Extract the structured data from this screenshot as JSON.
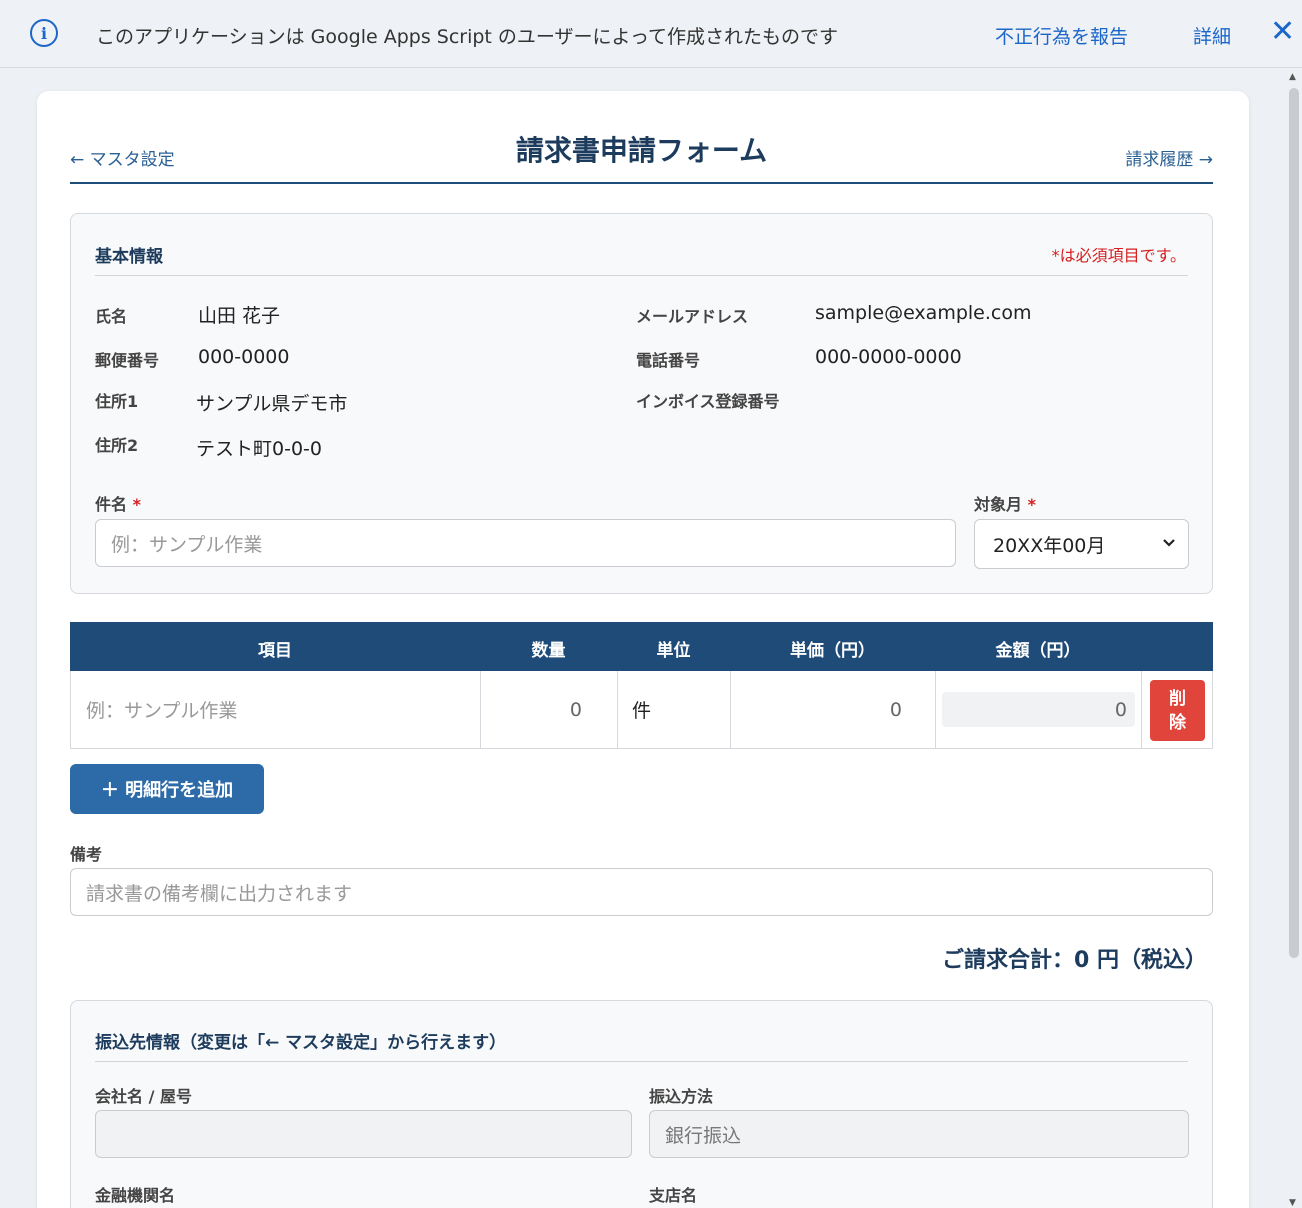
{
  "banner": {
    "message": "このアプリケーションは Google Apps Script のユーザーによって作成されたものです",
    "report": "不正行為を報告",
    "details": "詳細",
    "close": "✕"
  },
  "header": {
    "back_link": "← マスタ設定",
    "title": "請求書申請フォーム",
    "history_link": "請求履歴 →"
  },
  "basic": {
    "title": "基本情報",
    "required_note": "*は必須項目です。",
    "name_label": "氏名",
    "name_value": "山田 花子",
    "email_label": "メールアドレス",
    "email_value": "sample@example.com",
    "postal_label": "郵便番号",
    "postal_value": "000-0000",
    "phone_label": "電話番号",
    "phone_value": "000-0000-0000",
    "address1_label": "住所1",
    "address1_value": "サンプル県デモ市",
    "invoice_label": "インボイス登録番号",
    "address2_label": "住所2",
    "address2_value": "テスト町0-0-0",
    "subject_label": "件名",
    "subject_placeholder": "例：サンプル作業",
    "month_label": "対象月",
    "month_value": "20XX年00月",
    "required_mark": "*"
  },
  "items_table": {
    "headers": [
      "項目",
      "数量",
      "単位",
      "単価（円）",
      "金額（円）"
    ],
    "row": {
      "item_placeholder": "例：サンプル作業",
      "quantity": "0",
      "unit": "件",
      "unit_price": "0",
      "amount": "0",
      "delete_label": "削除"
    },
    "add_button": "＋ 明細行を追加"
  },
  "remarks": {
    "label": "備考",
    "placeholder": "請求書の備考欄に出力されます"
  },
  "total": "ご請求合計：0 円（税込）",
  "bank": {
    "title": "振込先情報（変更は「← マスタ設定」から行えます）",
    "company_label": "会社名 / 屋号",
    "company_value": "",
    "method_label": "振込方法",
    "method_value": "銀行振込",
    "bank_label": "金融機関名",
    "branch_label": "支店名"
  },
  "colors": {
    "primary": "#1f4b78",
    "link": "#1a66c9",
    "danger": "#e0443a",
    "button": "#2c6aa8"
  }
}
